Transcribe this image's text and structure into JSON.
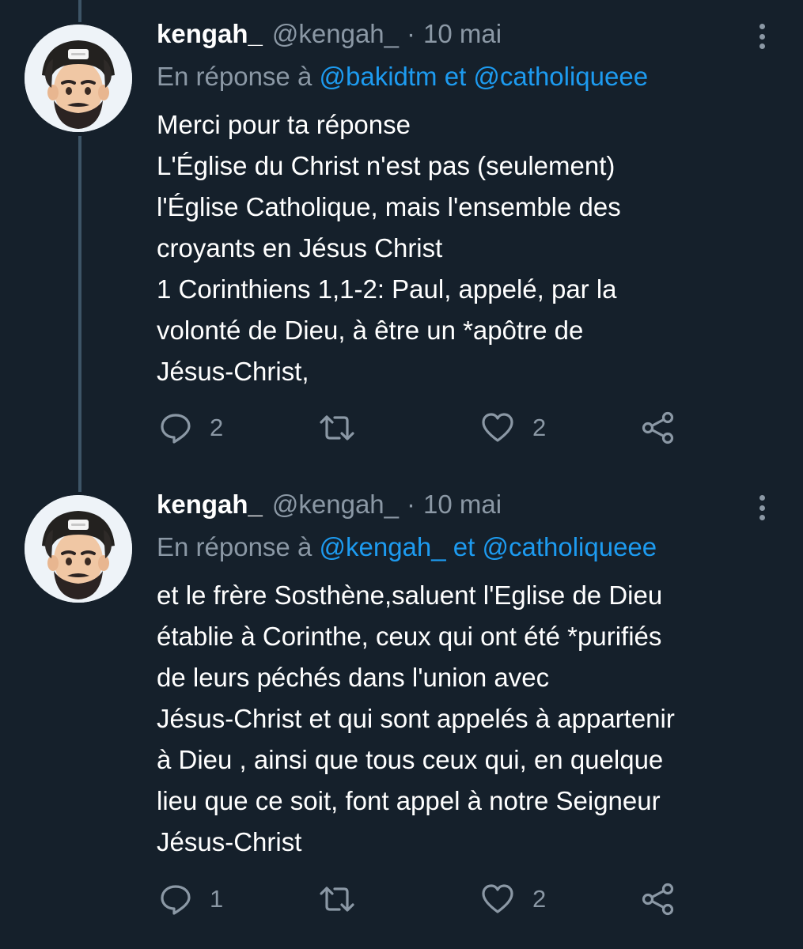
{
  "tweets": [
    {
      "display_name": "kengah_",
      "handle": "@kengah_",
      "separator": "·",
      "date": "10 mai",
      "reply_prefix": "En réponse à",
      "reply_to_1": "@bakidtm",
      "reply_conj": "et",
      "reply_to_2": "@catholiqueee",
      "lines": [
        "Merci pour ta réponse",
        "L'Église du Christ n'est pas (seulement)",
        "l'Église Catholique, mais l'ensemble des",
        "croyants en Jésus Christ",
        "1 Corinthiens 1,1-2: Paul, appelé, par la",
        "volonté de Dieu, à être un *apôtre de",
        "Jésus-Christ,"
      ],
      "replies": "2",
      "retweets": "",
      "likes": "2"
    },
    {
      "display_name": "kengah_",
      "handle": "@kengah_",
      "separator": "·",
      "date": "10 mai",
      "reply_prefix": "En réponse à",
      "reply_to_1": "@kengah_",
      "reply_conj": "et",
      "reply_to_2": "@catholiqueee",
      "lines": [
        "et le frère Sosthène,saluent l'Eglise de Dieu",
        "établie à Corinthe, ceux qui ont été *purifiés",
        "de leurs péchés dans l'union avec",
        "Jésus-Christ et qui sont appelés à appartenir",
        "à Dieu , ainsi que tous ceux qui, en quelque",
        "lieu que ce soit, font appel à notre Seigneur",
        "Jésus-Christ"
      ],
      "replies": "1",
      "retweets": "",
      "likes": "2"
    }
  ],
  "icons": {
    "reply": "speech-bubble-icon",
    "retweet": "retweet-arrows-icon",
    "like": "heart-outline-icon",
    "share": "share-nodes-icon",
    "more": "vertical-dots-icon"
  },
  "colors": {
    "background": "#15202b",
    "text": "#ffffff",
    "muted": "#8b98a5",
    "link": "#1d9bf0",
    "thread_line": "#3d5466"
  }
}
